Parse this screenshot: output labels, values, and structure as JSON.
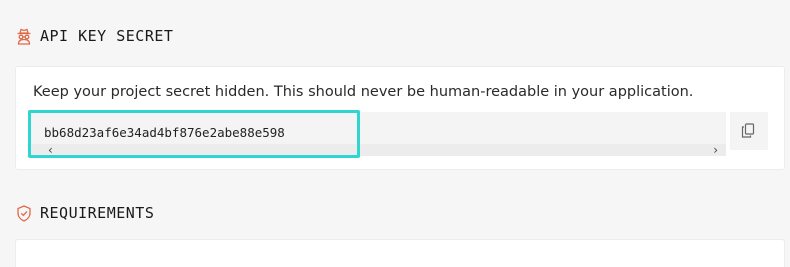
{
  "api_key_section": {
    "title": "API KEY SECRET",
    "icon": "incognito-icon",
    "description": "Keep your project secret hidden. This should never be human-readable in your application.",
    "secret_value": "bb68d23af6e34ad4bf876e2abe88e598",
    "copy_icon": "copy-icon"
  },
  "requirements_section": {
    "title": "REQUIREMENTS",
    "icon": "shield-check-icon"
  },
  "colors": {
    "accent": "#e0694a",
    "highlight": "#2fd5cf",
    "background": "#f6f6f6",
    "card": "#ffffff"
  }
}
